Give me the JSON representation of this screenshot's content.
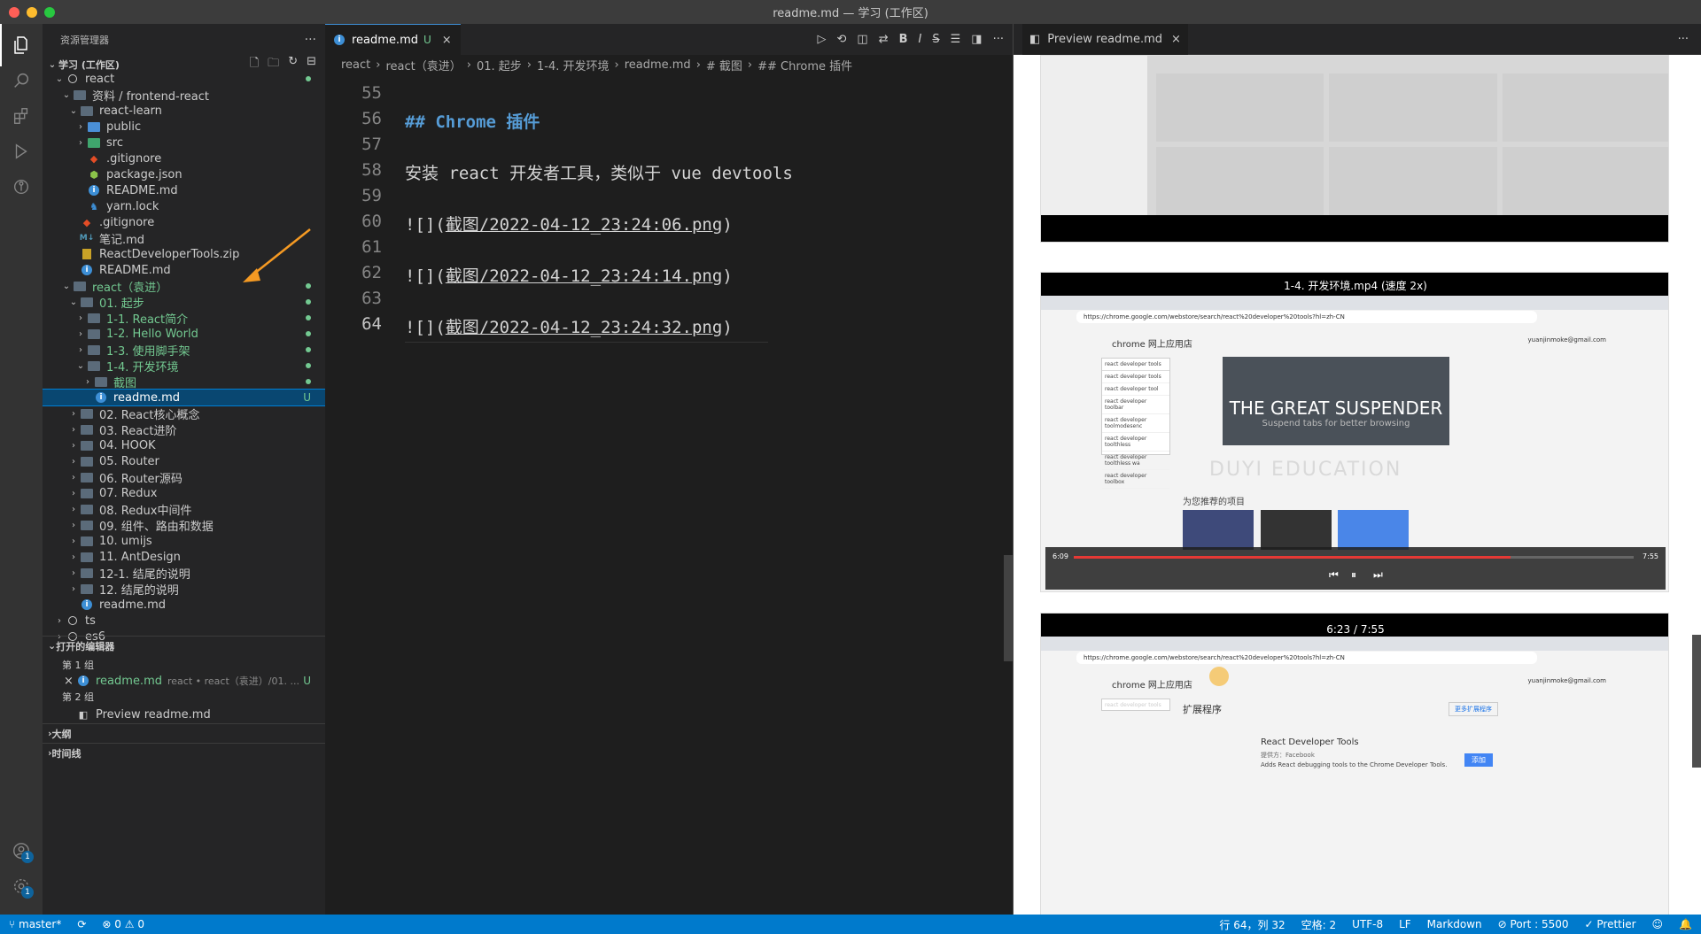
{
  "window": {
    "title": "readme.md — 学习 (工作区)"
  },
  "colors": {
    "accent": "#007acc",
    "modified": "#73c991",
    "selection": "#094771"
  },
  "sidebar": {
    "title": "资源管理器",
    "workspace": "学习 (工作区)",
    "tree": [
      {
        "label": "react",
        "depth": 1,
        "kind": "root",
        "dot": true
      },
      {
        "label": "资料 / frontend-react",
        "depth": 2,
        "kind": "folder"
      },
      {
        "label": "react-learn",
        "depth": 3,
        "kind": "folder"
      },
      {
        "label": "public",
        "depth": 4,
        "kind": "folder-blue"
      },
      {
        "label": "src",
        "depth": 4,
        "kind": "folder-green"
      },
      {
        "label": ".gitignore",
        "depth": 4,
        "kind": "git"
      },
      {
        "label": "package.json",
        "depth": 4,
        "kind": "json"
      },
      {
        "label": "README.md",
        "depth": 4,
        "kind": "info"
      },
      {
        "label": "yarn.lock",
        "depth": 4,
        "kind": "yarn"
      },
      {
        "label": ".gitignore",
        "depth": 3,
        "kind": "git"
      },
      {
        "label": "笔记.md",
        "depth": 3,
        "kind": "md"
      },
      {
        "label": "ReactDeveloperTools.zip",
        "depth": 3,
        "kind": "zip"
      },
      {
        "label": "README.md",
        "depth": 3,
        "kind": "info"
      },
      {
        "label": "react（袁进）",
        "depth": 2,
        "kind": "folder",
        "dot": true,
        "green": true
      },
      {
        "label": "01. 起步",
        "depth": 3,
        "kind": "folder",
        "dot": true,
        "green": true
      },
      {
        "label": "1-1. React简介",
        "depth": 4,
        "kind": "folder",
        "dot": true,
        "green": true
      },
      {
        "label": "1-2. Hello World",
        "depth": 4,
        "kind": "folder",
        "dot": true,
        "green": true
      },
      {
        "label": "1-3. 使用脚手架",
        "depth": 4,
        "kind": "folder",
        "dot": true,
        "green": true
      },
      {
        "label": "1-4. 开发环境",
        "depth": 4,
        "kind": "folder",
        "dot": true,
        "green": true
      },
      {
        "label": "截图",
        "depth": 5,
        "kind": "folder",
        "dot": true,
        "green": true
      },
      {
        "label": "readme.md",
        "depth": 5,
        "kind": "info",
        "selected": true,
        "status": "U"
      },
      {
        "label": "02. React核心概念",
        "depth": 3,
        "kind": "folder"
      },
      {
        "label": "03. React进阶",
        "depth": 3,
        "kind": "folder"
      },
      {
        "label": "04. HOOK",
        "depth": 3,
        "kind": "folder"
      },
      {
        "label": "05. Router",
        "depth": 3,
        "kind": "folder"
      },
      {
        "label": "06. Router源码",
        "depth": 3,
        "kind": "folder"
      },
      {
        "label": "07. Redux",
        "depth": 3,
        "kind": "folder"
      },
      {
        "label": "08. Redux中间件",
        "depth": 3,
        "kind": "folder"
      },
      {
        "label": "09. 组件、路由和数据",
        "depth": 3,
        "kind": "folder"
      },
      {
        "label": "10. umijs",
        "depth": 3,
        "kind": "folder"
      },
      {
        "label": "11. AntDesign",
        "depth": 3,
        "kind": "folder"
      },
      {
        "label": "12-1. 结尾的说明",
        "depth": 3,
        "kind": "folder"
      },
      {
        "label": "12. 结尾的说明",
        "depth": 3,
        "kind": "folder"
      },
      {
        "label": "readme.md",
        "depth": 3,
        "kind": "info"
      },
      {
        "label": "ts",
        "depth": 1,
        "kind": "root"
      },
      {
        "label": "es6",
        "depth": 1,
        "kind": "root"
      }
    ],
    "open_editors": {
      "title": "打开的编辑器",
      "group1": "第 1 组",
      "item1": "readme.md",
      "item1_path": "react • react（袁进）/01. ...",
      "item1_status": "U",
      "group2": "第 2 组",
      "item2": "Preview readme.md"
    },
    "outline": "大纲",
    "timeline": "时间线"
  },
  "editor": {
    "tab_label": "readme.md",
    "tab_status": "U",
    "breadcrumbs": [
      "react",
      "react（袁进）",
      "01. 起步",
      "1-4. 开发环境",
      "readme.md",
      "# 截图",
      "## Chrome 插件"
    ],
    "lines": [
      {
        "n": "55",
        "text": ""
      },
      {
        "n": "56",
        "text": "## Chrome 插件",
        "type": "heading"
      },
      {
        "n": "57",
        "text": ""
      },
      {
        "n": "58",
        "text": "安装 react 开发者工具，类似于 vue devtools"
      },
      {
        "n": "59",
        "text": ""
      },
      {
        "n": "60",
        "pre": "![](",
        "link": "截图/2022-04-12_23:24:06.png",
        "post": ")"
      },
      {
        "n": "61",
        "text": ""
      },
      {
        "n": "62",
        "pre": "![](",
        "link": "截图/2022-04-12_23:24:14.png",
        "post": ")"
      },
      {
        "n": "63",
        "text": ""
      },
      {
        "n": "64",
        "pre": "![](",
        "link": "截图/2022-04-12_23:24:32.png",
        "post": ")",
        "current": true
      }
    ]
  },
  "preview": {
    "tab_label": "Preview readme.md",
    "shot2_title": "1-4. 开发环境.mp4 (速度 2x)",
    "shot2_url": "https://chrome.google.com/webstore/search/react%20developer%20tools?hl=zh-CN",
    "store_title": "chrome 网上应用店",
    "account": "yuanjinmoke@gmail.com",
    "search_value": "react developer tools",
    "suggestions": [
      "react developer tools",
      "react developer tool",
      "react developer toolbar",
      "react developer toolmodesenc",
      "react developer toolthless",
      "react developer toolthless wa",
      "react developer toolbox"
    ],
    "banner_title": "THE GREAT SUSPENDER",
    "banner_sub": "Suspend tabs for better browsing",
    "recommend": "为您推荐的项目",
    "watermark": "DUYI EDUCATION",
    "time_current": "6:09",
    "time_total": "7:55",
    "progress": 0.78,
    "shot3_time": "6:23 / 7:55",
    "ext_header": "扩展程序",
    "ext_name": "React Developer Tools",
    "ext_provider": "提供方：Facebook",
    "ext_desc": "Adds React debugging tools to the Chrome Developer Tools.",
    "ext_btn": "添加",
    "more_btn": "更多扩展程序"
  },
  "status": {
    "branch": "master*",
    "errors": "0",
    "warnings": "0",
    "position": "行 64，列 32",
    "spaces": "空格: 2",
    "encoding": "UTF-8",
    "eol": "LF",
    "language": "Markdown",
    "port": "Port : 5500",
    "formatter": "Prettier"
  }
}
